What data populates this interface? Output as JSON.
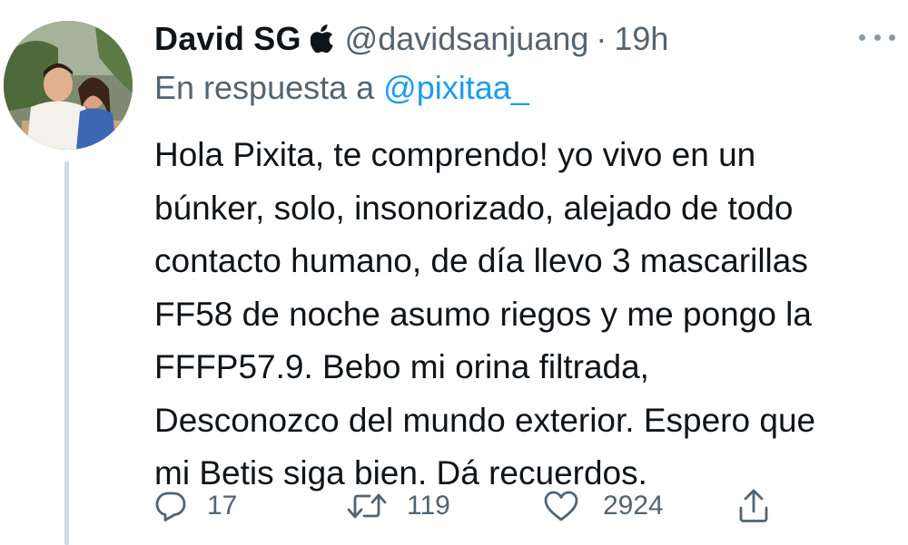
{
  "tweet": {
    "author": {
      "display_name": "David SG",
      "badge_icon": "apple-icon",
      "handle": "@davidsanjuang",
      "separator": "·",
      "time": "19h"
    },
    "reply_to": {
      "prefix": "En respuesta a",
      "handle": "@pixitaa_"
    },
    "body_lines": [
      "Hola Pixita, te comprendo! yo vivo en un",
      "búnker, solo, insonorizado, alejado de todo",
      "contacto humano, de día llevo 3 mascarillas",
      "FF58 de noche asumo riegos y me pongo la",
      "FFFP57.9. Bebo mi orina filtrada,",
      "Desconozco del mundo exterior. Espero que",
      "mi Betis siga bien. Dá recuerdos."
    ],
    "actions": {
      "replies": {
        "icon": "reply-icon",
        "count": "17"
      },
      "retweets": {
        "icon": "retweet-icon",
        "count": "119"
      },
      "likes": {
        "icon": "heart-icon",
        "count": "2924"
      },
      "share": {
        "icon": "share-icon"
      }
    },
    "more_icon": "more-icon"
  },
  "colors": {
    "text_primary": "#0f1419",
    "text_secondary": "#536471",
    "link": "#1d9bf0",
    "thread_line": "#cfd9de"
  }
}
